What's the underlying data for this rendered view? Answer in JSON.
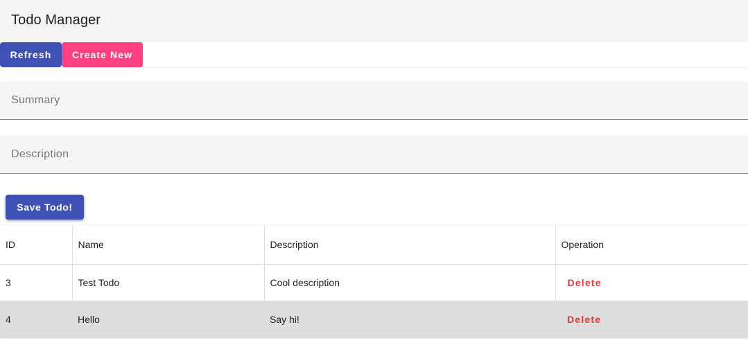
{
  "header": {
    "title": "Todo Manager"
  },
  "toolbar": {
    "refresh_label": "Refresh",
    "create_label": "Create New"
  },
  "form": {
    "summary_placeholder": "Summary",
    "summary_value": "",
    "description_placeholder": "Description",
    "description_value": "",
    "save_label": "Save Todo!"
  },
  "table": {
    "columns": [
      "ID",
      "Name",
      "Description",
      "Operation"
    ],
    "rows": [
      {
        "id": "3",
        "name": "Test Todo",
        "description": "Cool description",
        "operation": "Delete"
      },
      {
        "id": "4",
        "name": "Hello",
        "description": "Say hi!",
        "operation": "Delete"
      }
    ]
  },
  "colors": {
    "primary": "#3f51b5",
    "accent": "#ff4081",
    "delete": "#e53935",
    "highlight_row": "#dddddd"
  }
}
